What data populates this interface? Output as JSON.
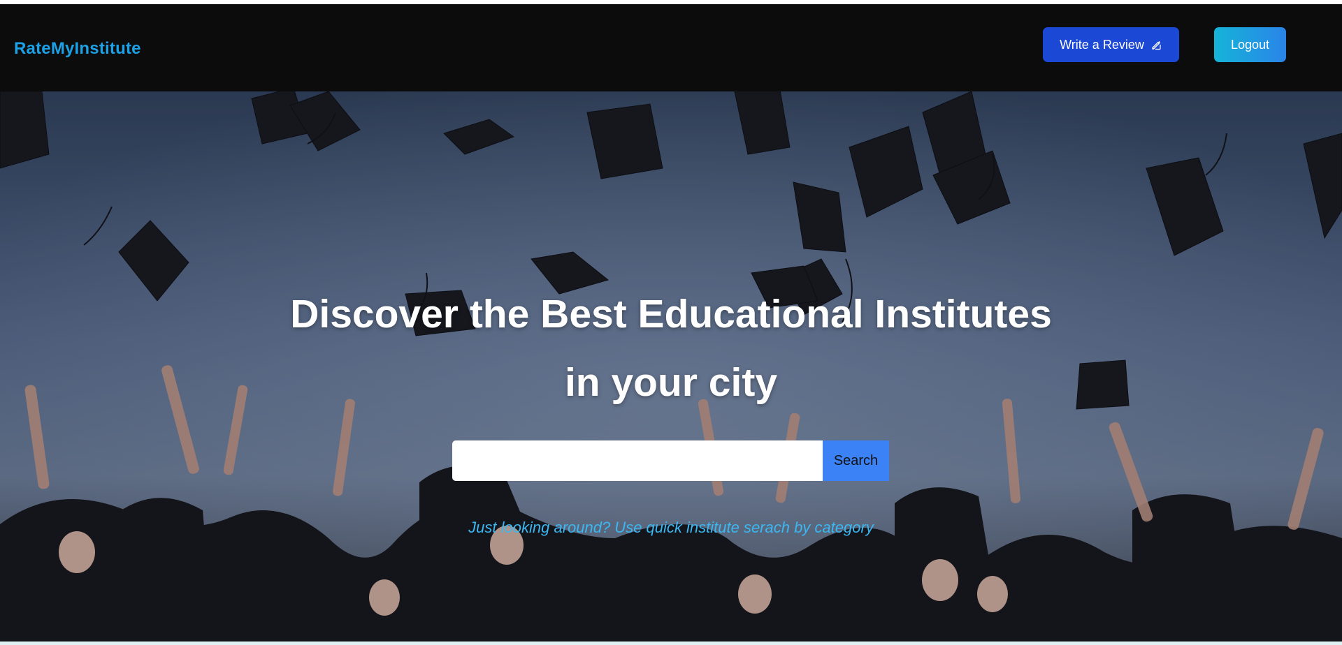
{
  "navbar": {
    "brand": "RateMyInstitute",
    "write_review_label": "Write a Review",
    "write_review_icon": "edit-icon",
    "logout_label": "Logout"
  },
  "hero": {
    "title_line1": "Discover the Best Educational Institutes",
    "title_line2": "in your city",
    "search": {
      "value": "",
      "placeholder": "",
      "button_label": "Search"
    },
    "quick_link": "Just looking around? Use quick institute serach by category",
    "background": "graduation-caps-photo"
  },
  "colors": {
    "navbar_bg": "#0c0c0c",
    "brand": "#1da1e6",
    "review_button": "#1c48d6",
    "logout_button_start": "#15b4d8",
    "logout_button_end": "#2a84e8",
    "search_button": "#3b82f6",
    "quick_link": "#3cb7f2"
  }
}
